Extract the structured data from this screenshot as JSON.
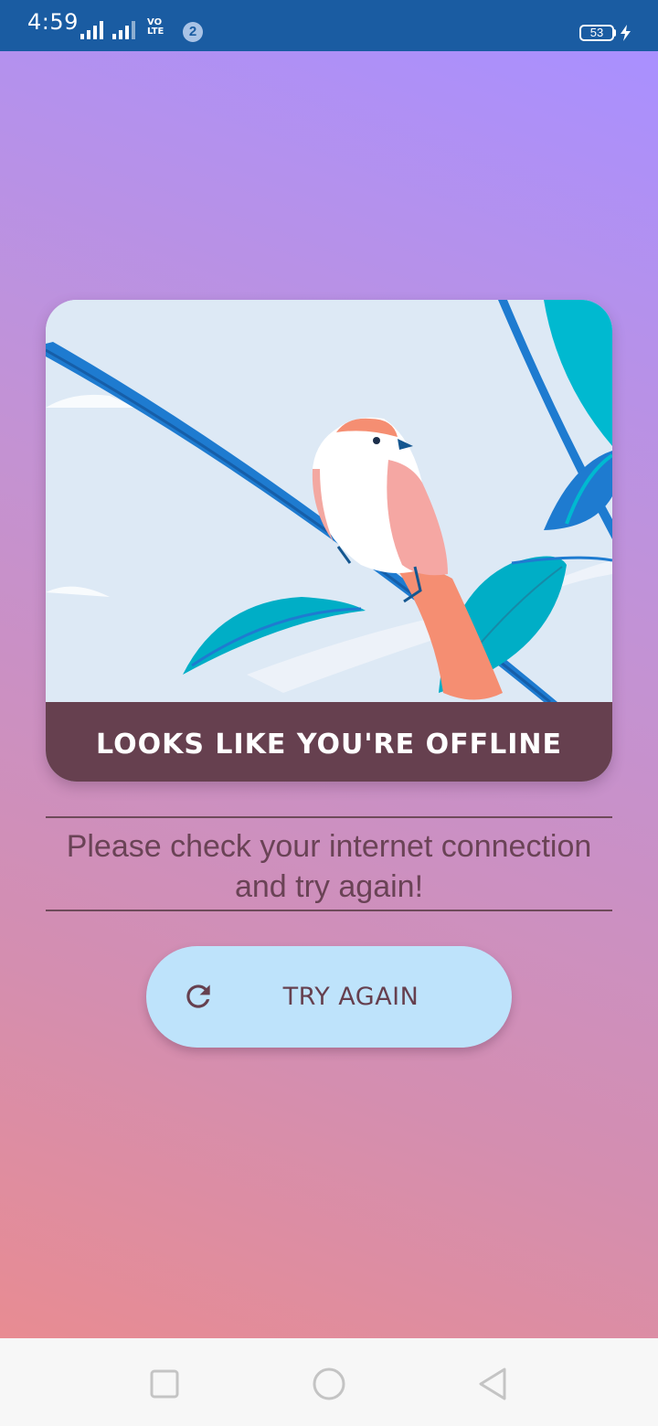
{
  "status_bar": {
    "time": "4:59",
    "volte_top": "VO",
    "volte_bottom": "LTE",
    "notification_count": "2",
    "battery_level": "53"
  },
  "card": {
    "title": "LOOKS LIKE YOU'RE OFFLINE",
    "illustration": "bird-on-branch"
  },
  "message": {
    "line1": "Please check your internet connection",
    "line2": "and try again!"
  },
  "retry_button": {
    "label": "TRY AGAIN",
    "icon": "refresh-icon"
  },
  "nav_bar": {
    "items": [
      "recent-apps",
      "home",
      "back"
    ]
  },
  "colors": {
    "status_bar": "#1a5ca2",
    "card_footer": "#66404f",
    "button_bg": "#bee3fb",
    "text": "#6a4356"
  }
}
